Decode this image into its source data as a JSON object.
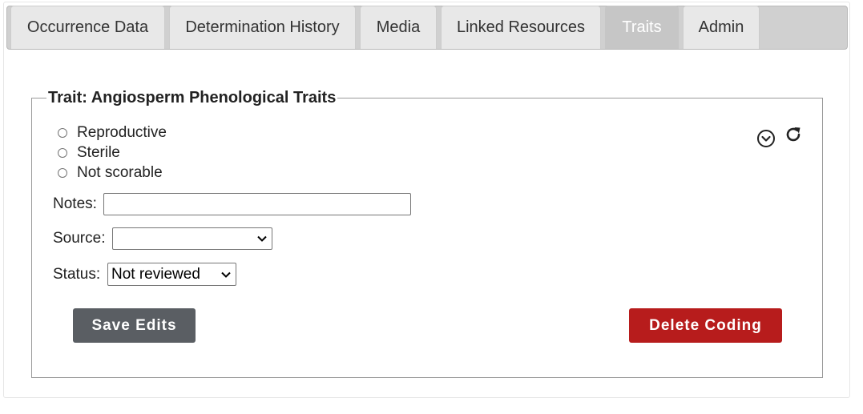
{
  "tabs": [
    {
      "label": "Occurrence Data",
      "active": false
    },
    {
      "label": "Determination History",
      "active": false
    },
    {
      "label": "Media",
      "active": false
    },
    {
      "label": "Linked Resources",
      "active": false
    },
    {
      "label": "Traits",
      "active": true
    },
    {
      "label": "Admin",
      "active": false
    }
  ],
  "trait": {
    "legend": "Trait: Angiosperm Phenological Traits",
    "options": [
      {
        "label": "Reproductive",
        "checked": false
      },
      {
        "label": "Sterile",
        "checked": false
      },
      {
        "label": "Not scorable",
        "checked": false
      }
    ],
    "notes_label": "Notes:",
    "notes_value": "",
    "source_label": "Source:",
    "source_value": "",
    "status_label": "Status:",
    "status_value": "Not reviewed",
    "icons": {
      "expand": "chevron-down-circle-icon",
      "refresh": "refresh-icon"
    }
  },
  "buttons": {
    "save_label": "Save Edits",
    "delete_label": "Delete Coding"
  },
  "colors": {
    "save_button": "#5a5e63",
    "delete_button": "#b71c1c",
    "active_tab": "#c6c6c6",
    "tab_bar": "#d0d0d0"
  }
}
